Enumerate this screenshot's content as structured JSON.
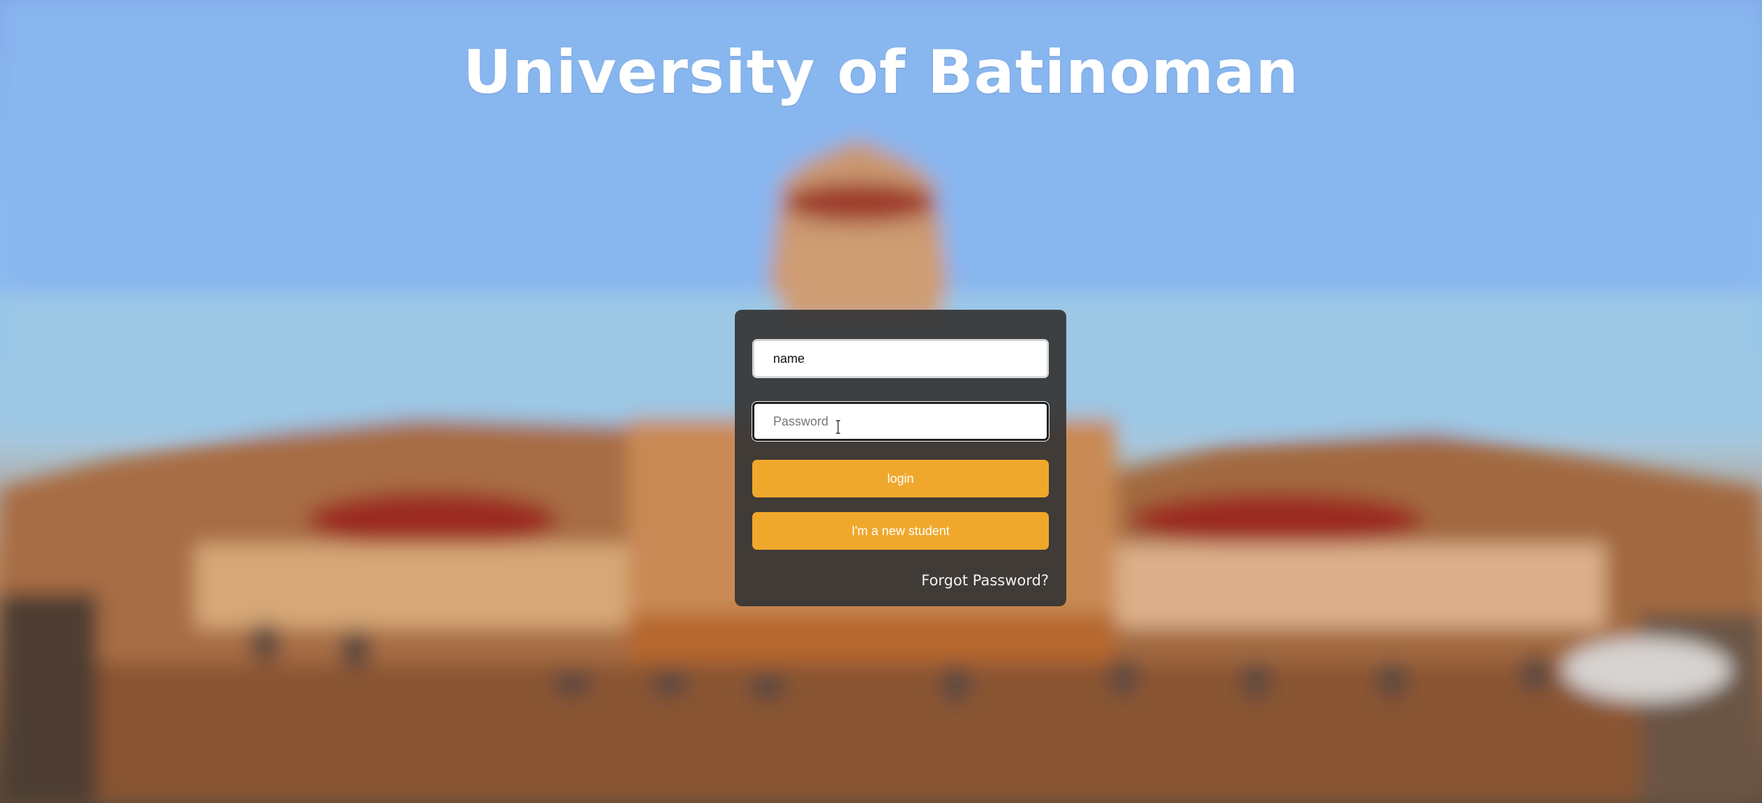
{
  "page": {
    "title": "University of Batinoman"
  },
  "login_form": {
    "name_value": "name",
    "password_placeholder": "Password",
    "login_label": "login",
    "new_student_label": "I'm a new student",
    "forgot_password_label": "Forgot Password?"
  },
  "colors": {
    "button_accent": "#efa82c",
    "panel_background": "#343434",
    "title_text": "#ffffff"
  }
}
